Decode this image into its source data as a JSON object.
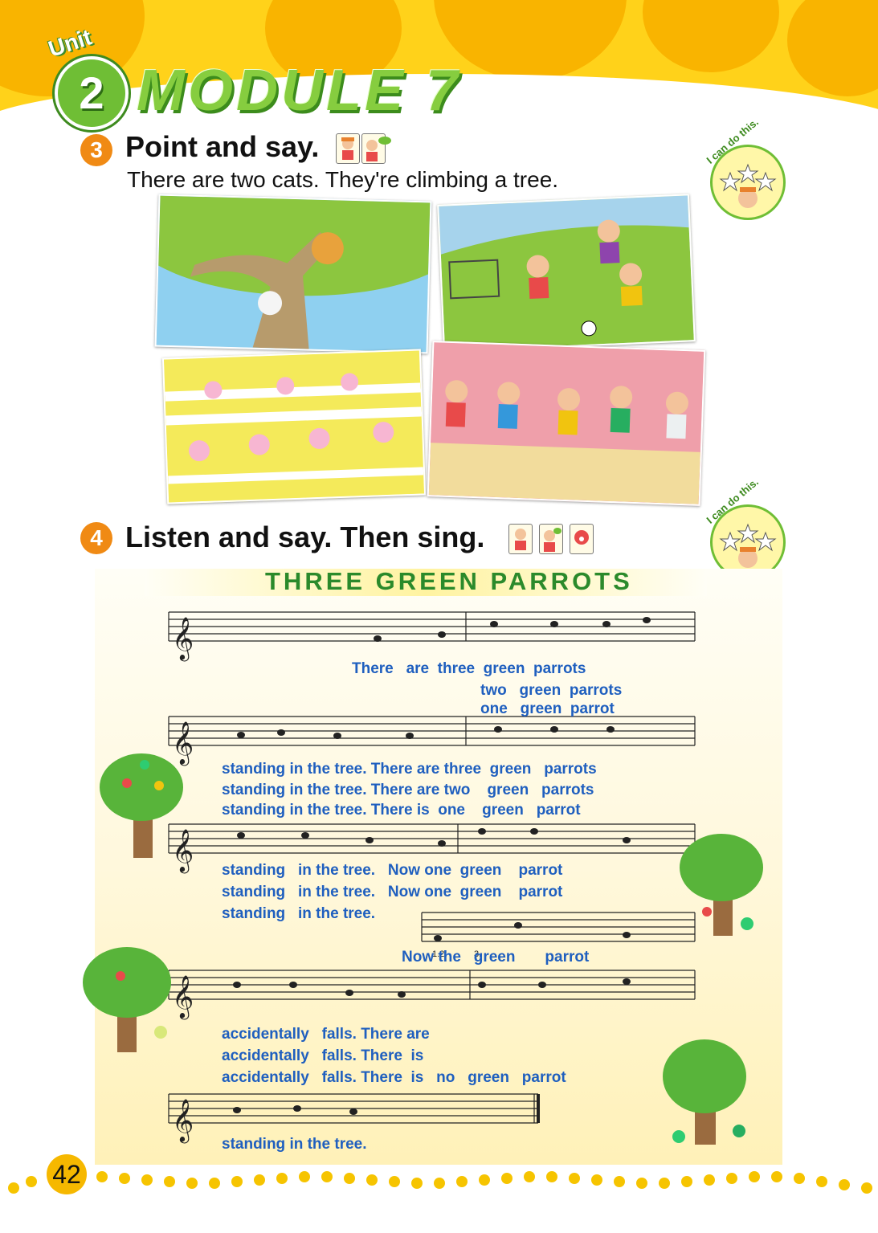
{
  "header": {
    "unit_label": "Unit",
    "unit_number": "2",
    "module_title": "MODULE 7"
  },
  "section3": {
    "number": "3",
    "title": "Point and say.",
    "instruction": "There are two cats. They're climbing a tree.",
    "badge_text": "I can do this.",
    "pictures": [
      "cats-climbing-tree",
      "boys-playing-football",
      "girls-dancing",
      "boys-running"
    ]
  },
  "section4": {
    "number": "4",
    "title": "Listen and say. Then sing.",
    "badge_text": "I can do this."
  },
  "song": {
    "title": "THREE GREEN PARROTS",
    "volta_1": "1.2.",
    "volta_2": "3.",
    "lines": [
      "There   are  three  green  parrots",
      "two   green  parrots",
      "one   green  parrot",
      "standing in the tree. There are three  green   parrots",
      "standing in the tree. There are two    green   parrots",
      "standing in the tree. There is  one    green   parrot",
      "standing   in the tree.   Now one  green    parrot",
      "standing   in the tree.   Now one  green    parrot",
      "standing   in the tree.",
      "Now the   green       parrot",
      "accidentally   falls. There are",
      "accidentally   falls. There  is",
      "accidentally   falls. There  is   no   green   parrot",
      "standing in the tree."
    ]
  },
  "footer": {
    "page_number": "42"
  },
  "colors": {
    "header_yellow": "#ffd21a",
    "accent_green": "#6fbe35",
    "section_orange": "#f08a14",
    "lyric_blue": "#1f5fbf",
    "song_title_green": "#2b8a2b"
  }
}
